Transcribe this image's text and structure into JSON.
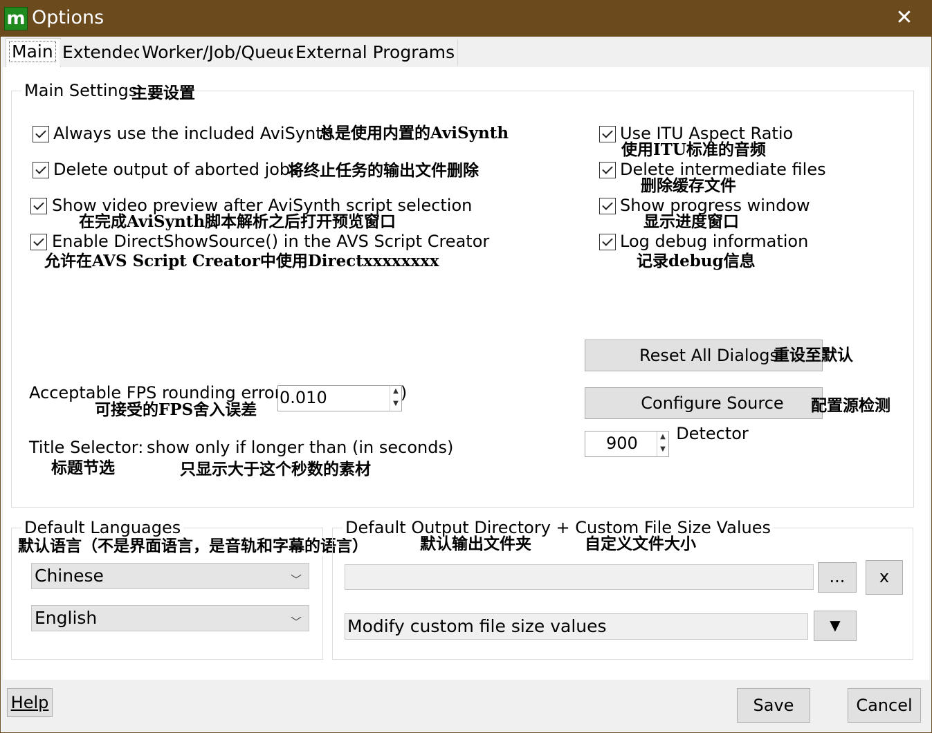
{
  "window": {
    "title": "Options",
    "app_icon_glyph": "m",
    "close_glyph": "✕"
  },
  "tabs": [
    "Main",
    "Extended",
    "Worker/Job/Queue",
    "External Programs"
  ],
  "main_settings": {
    "legend": "Main Settings",
    "legend_cn": "主要设置",
    "left_checks": [
      {
        "label": "Always use the included AviSynth",
        "cn": "总是使用内置的AviSynth",
        "checked": true
      },
      {
        "label": "Delete output of aborted jobs",
        "cn": "将终止任务的输出文件删除",
        "checked": true
      },
      {
        "label": "Show video preview after AviSynth script selection",
        "cn": "在完成AviSynth脚本解析之后打开预览窗口",
        "checked": true
      },
      {
        "label": "Enable DirectShowSource() in the AVS Script Creator",
        "cn": "允许在AVS Script Creator中使用Directxxxxxxxx",
        "checked": true
      }
    ],
    "right_checks": [
      {
        "label": "Use ITU Aspect Ratio",
        "cn": "使用ITU标准的音频",
        "checked": true
      },
      {
        "label": "Delete intermediate files",
        "cn": "删除缓存文件",
        "checked": true
      },
      {
        "label": "Show progress window",
        "cn": "显示进度窗口",
        "checked": true
      },
      {
        "label": "Log debug information",
        "cn": "记录debug信息",
        "checked": true
      }
    ],
    "fps": {
      "label": "Acceptable FPS rounding error (",
      "label_tail": "r)",
      "cn": "可接受的FPS舍入误差",
      "value": "0.010"
    },
    "title_selector": {
      "label": "Title Selector:",
      "label2": "show only if longer than (in seconds)",
      "cn1": "标题节选",
      "cn2": "只显示大于这个秒数的素材",
      "value": "900"
    },
    "reset_button": {
      "label": "Reset All Dialogs",
      "cn": "重设至默认"
    },
    "configure_button": {
      "label": "Configure Source Detector",
      "cn": "配置源检测"
    }
  },
  "default_languages": {
    "legend": "Default Languages",
    "cn": "默认语言（不是界面语言，是音轨和字幕的语言）",
    "lang1": "Chinese",
    "lang2": "English"
  },
  "output": {
    "legend": "Default Output Directory + Custom File Size Values",
    "cn1": "默认输出文件夹",
    "cn2": "自定义文件大小",
    "dir_value": "",
    "browse_label": "...",
    "clear_label": "x",
    "custom_size": "Modify custom file size values"
  },
  "footer": {
    "help": "Help",
    "save": "Save",
    "cancel": "Cancel"
  }
}
